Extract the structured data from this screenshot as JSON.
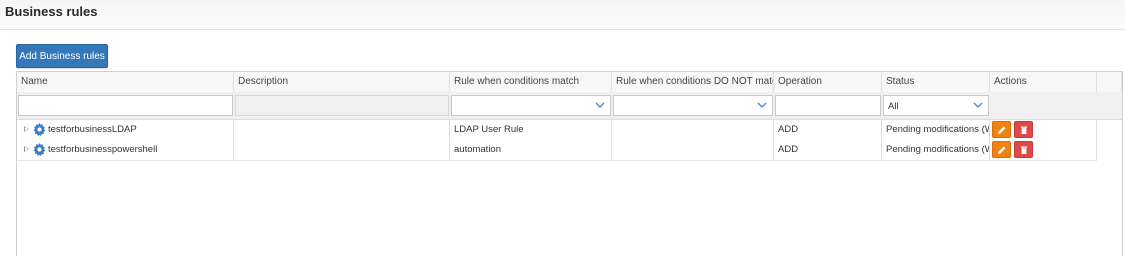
{
  "page": {
    "title": "Business rules"
  },
  "toolbar": {
    "add_label": "Add Business rules"
  },
  "colors": {
    "primary": "#3478b9",
    "edit": "#f0820f",
    "delete": "#dd4b48"
  },
  "grid": {
    "columns": [
      "Name",
      "Description",
      "Rule when conditions match",
      "Rule when conditions DO NOT match",
      "Operation",
      "Status",
      "Actions"
    ],
    "filters": {
      "status_selected": "All"
    },
    "rows": [
      {
        "name": "testforbusinessLDAP",
        "description": "",
        "rule_match": "LDAP User Rule",
        "rule_no_match": "",
        "operation": "ADD",
        "status": "Pending modifications (Wi"
      },
      {
        "name": "testforbusinesspowershell",
        "description": "",
        "rule_match": "automation",
        "rule_no_match": "",
        "operation": "ADD",
        "status": "Pending modifications (Wi"
      }
    ]
  }
}
